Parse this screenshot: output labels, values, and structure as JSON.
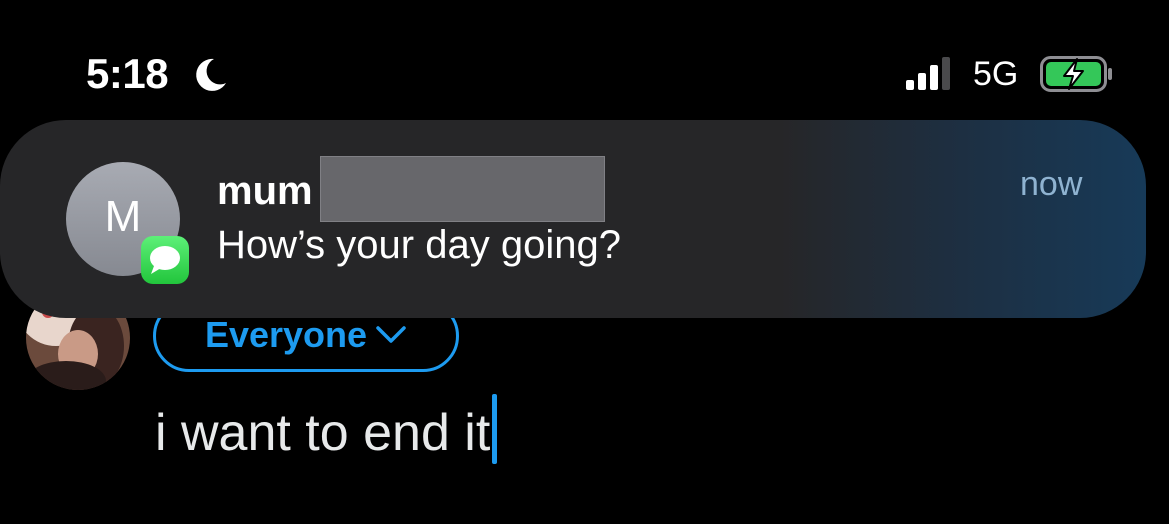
{
  "status_bar": {
    "time": "5:18",
    "focus_icon": "moon-icon",
    "signal_icon": "cellular-signal-icon",
    "network": "5G",
    "battery_icon": "battery-charging-icon"
  },
  "composer": {
    "audience": "Everyone",
    "text": "i want to end it",
    "accent_color": "#1d9bf0"
  },
  "notification": {
    "contact_initial": "M",
    "app_icon": "messages-icon",
    "sender": "mum",
    "message": "How’s your day going?",
    "time": "now"
  }
}
